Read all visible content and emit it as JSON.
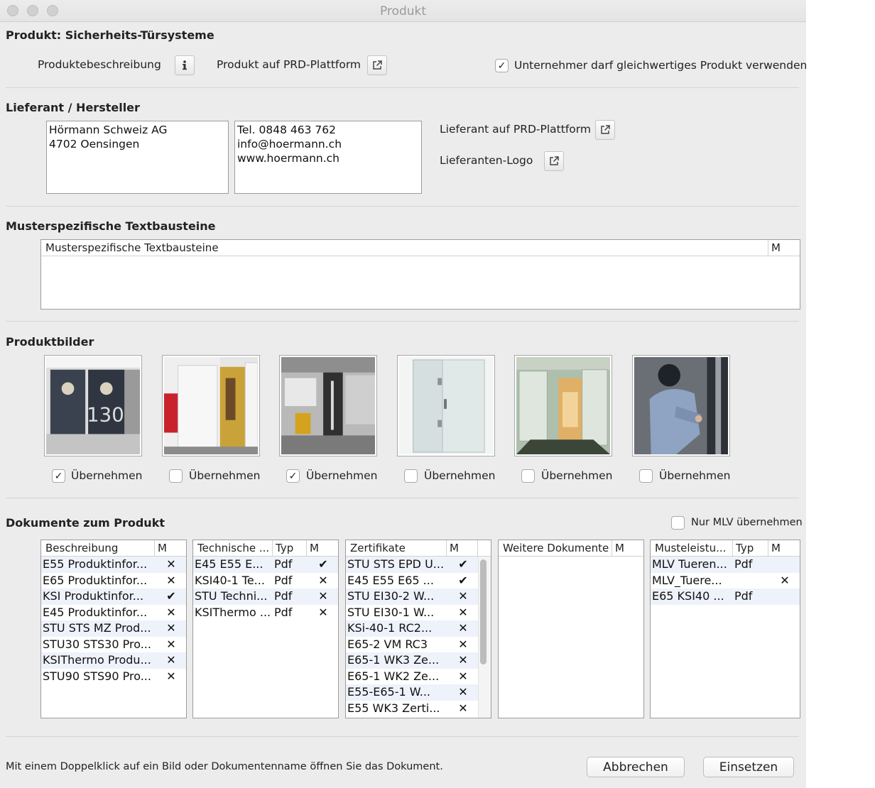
{
  "window": {
    "title": "Produkt"
  },
  "product": {
    "heading": "Produkt: Sicherheits-Türsysteme",
    "description_label": "Produktebeschreibung",
    "platform_label": "Produkt auf PRD-Plattform",
    "equivalent_label": "Unternehmer darf gleichwertiges Produkt verwenden",
    "equivalent_checked": true
  },
  "supplier": {
    "heading": "Lieferant / Hersteller",
    "address": "Hörmann Schweiz AG\n4702 Oensingen",
    "contact": "Tel. 0848 463 762\ninfo@hoermann.ch\nwww.hoermann.ch",
    "platform_label": "Lieferant auf PRD-Plattform",
    "logo_label": "Lieferanten-Logo"
  },
  "text_blocks": {
    "heading": "Musterspezifische Textbausteine",
    "col_name": "Musterspezifische Textbausteine",
    "col_m": "M"
  },
  "images": {
    "heading": "Produktbilder",
    "take_label": "Übernehmen",
    "items": [
      {
        "checked": true
      },
      {
        "checked": false
      },
      {
        "checked": true
      },
      {
        "checked": false
      },
      {
        "checked": false
      },
      {
        "checked": false
      }
    ]
  },
  "documents": {
    "heading": "Dokumente zum Produkt",
    "mlv_only_label": "Nur MLV übernehmen",
    "mlv_only_checked": false,
    "descriptions": {
      "col_name": "Beschreibung",
      "col_m": "M",
      "rows": [
        {
          "name": "E55 Produktinfor...",
          "m": "✕"
        },
        {
          "name": "E65 Produktinfor...",
          "m": "✕"
        },
        {
          "name": "KSI Produktinfor...",
          "m": "✔"
        },
        {
          "name": "E45 Produktinfor...",
          "m": "✕"
        },
        {
          "name": "STU STS MZ Prod...",
          "m": "✕"
        },
        {
          "name": "STU30 STS30 Pro...",
          "m": "✕"
        },
        {
          "name": "KSIThermo Produ...",
          "m": "✕"
        },
        {
          "name": "STU90 STS90 Pro...",
          "m": "✕"
        }
      ]
    },
    "technical": {
      "col_name": "Technische ...",
      "col_type": "Typ",
      "col_m": "M",
      "rows": [
        {
          "name": "E45 E55 E...",
          "type": "Pdf",
          "m": "✔"
        },
        {
          "name": "KSI40-1 Te...",
          "type": "Pdf",
          "m": "✕"
        },
        {
          "name": "STU Techni...",
          "type": "Pdf",
          "m": "✕"
        },
        {
          "name": "KSIThermo ...",
          "type": "Pdf",
          "m": "✕"
        }
      ]
    },
    "certificates": {
      "col_name": "Zertifikate",
      "col_m": "M",
      "rows": [
        {
          "name": "STU STS EPD U...",
          "m": "✔"
        },
        {
          "name": "E45 E55 E65 ...",
          "m": "✔"
        },
        {
          "name": "STU EI30-2 W...",
          "m": "✕"
        },
        {
          "name": "STU EI30-1 W...",
          "m": "✕"
        },
        {
          "name": "KSi-40-1 RC2...",
          "m": "✕"
        },
        {
          "name": "E65-2 VM RC3",
          "m": "✕"
        },
        {
          "name": "E65-1 WK3 Ze...",
          "m": "✕"
        },
        {
          "name": "E65-1 WK2 Ze...",
          "m": "✕"
        },
        {
          "name": "E55-E65-1 W...",
          "m": "✕"
        },
        {
          "name": "E55 WK3 Zerti...",
          "m": "✕"
        }
      ]
    },
    "further": {
      "col_name": "Weitere Dokumente",
      "col_m": "M",
      "rows": []
    },
    "model_specs": {
      "col_name": "Musteleistu...",
      "col_type": "Typ",
      "col_m": "M",
      "rows": [
        {
          "name": "MLV Tueren...",
          "type": "Pdf",
          "m": ""
        },
        {
          "name": "MLV_Tuere...",
          "type": "",
          "m": "✕"
        },
        {
          "name": "E65 KSI40 ...",
          "type": "Pdf",
          "m": ""
        }
      ]
    }
  },
  "footer": {
    "hint": "Mit einem Doppelklick auf ein Bild oder Dokumentenname öffnen Sie das Dokument.",
    "cancel_label": "Abbrechen",
    "insert_label": "Einsetzen"
  }
}
